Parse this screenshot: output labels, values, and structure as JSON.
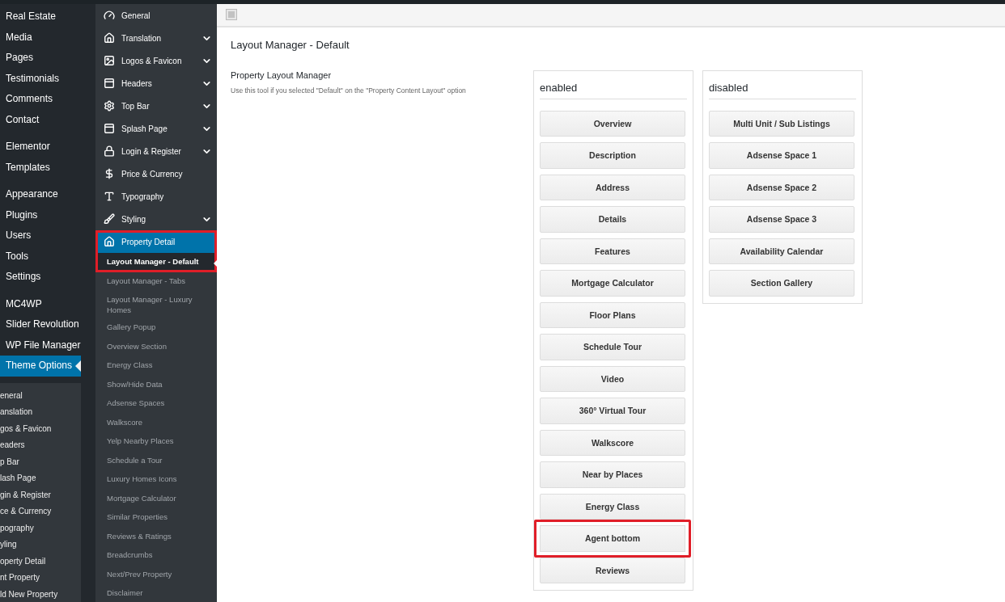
{
  "admin_menu": {
    "groups": [
      {
        "items": [
          {
            "label": "Real Estate",
            "selected": false
          },
          {
            "label": "Media",
            "selected": false
          },
          {
            "label": "Pages",
            "selected": false
          },
          {
            "label": "Testimonials",
            "selected": false
          },
          {
            "label": "Comments",
            "selected": false
          },
          {
            "label": "Contact",
            "selected": false
          }
        ]
      },
      {
        "items": [
          {
            "label": "Elementor",
            "selected": false
          },
          {
            "label": "Templates",
            "selected": false
          }
        ]
      },
      {
        "items": [
          {
            "label": "Appearance",
            "selected": false
          },
          {
            "label": "Plugins",
            "selected": false
          },
          {
            "label": "Users",
            "selected": false
          },
          {
            "label": "Tools",
            "selected": false
          },
          {
            "label": "Settings",
            "selected": false
          }
        ]
      },
      {
        "items": [
          {
            "label": "MC4WP",
            "selected": false
          },
          {
            "label": "Slider Revolution",
            "selected": false
          },
          {
            "label": "WP File Manager",
            "selected": false
          },
          {
            "label": "Theme Options",
            "selected": true
          }
        ]
      }
    ],
    "submenu": [
      "eneral",
      "anslation",
      "gos & Favicon",
      "eaders",
      "p Bar",
      "lash Page",
      "gin & Register",
      "ce & Currency",
      "pography",
      "yling",
      "operty Detail",
      "nt Property",
      "ld New Property"
    ]
  },
  "options_menu": {
    "sections": [
      {
        "label": "General",
        "expandable": false,
        "selected": false,
        "highlighted": false
      },
      {
        "label": "Translation",
        "expandable": true,
        "selected": false,
        "highlighted": false
      },
      {
        "label": "Logos & Favicon",
        "expandable": true,
        "selected": false,
        "highlighted": false
      },
      {
        "label": "Headers",
        "expandable": true,
        "selected": false,
        "highlighted": false
      },
      {
        "label": "Top Bar",
        "expandable": true,
        "selected": false,
        "highlighted": false
      },
      {
        "label": "Splash Page",
        "expandable": true,
        "selected": false,
        "highlighted": false
      },
      {
        "label": "Login & Register",
        "expandable": true,
        "selected": false,
        "highlighted": false
      },
      {
        "label": "Price & Currency",
        "expandable": false,
        "selected": false,
        "highlighted": false
      },
      {
        "label": "Typography",
        "expandable": false,
        "selected": false,
        "highlighted": false
      },
      {
        "label": "Styling",
        "expandable": true,
        "selected": false,
        "highlighted": false
      },
      {
        "label": "Property Detail",
        "expandable": false,
        "selected": true,
        "highlighted": true
      }
    ],
    "subitems": [
      {
        "label": "Layout Manager - Default",
        "selected": true,
        "highlighted": true
      },
      {
        "label": "Layout Manager - Tabs",
        "selected": false,
        "highlighted": false
      },
      {
        "label": "Layout Manager - Luxury Homes",
        "selected": false,
        "highlighted": false
      },
      {
        "label": "Gallery Popup",
        "selected": false,
        "highlighted": false
      },
      {
        "label": "Overview Section",
        "selected": false,
        "highlighted": false
      },
      {
        "label": "Energy Class",
        "selected": false,
        "highlighted": false
      },
      {
        "label": "Show/Hide Data",
        "selected": false,
        "highlighted": false
      },
      {
        "label": "Adsense Spaces",
        "selected": false,
        "highlighted": false
      },
      {
        "label": "Walkscore",
        "selected": false,
        "highlighted": false
      },
      {
        "label": "Yelp Nearby Places",
        "selected": false,
        "highlighted": false
      },
      {
        "label": "Schedule a Tour",
        "selected": false,
        "highlighted": false
      },
      {
        "label": "Luxury Homes Icons",
        "selected": false,
        "highlighted": false
      },
      {
        "label": "Mortgage Calculator",
        "selected": false,
        "highlighted": false
      },
      {
        "label": "Similar Properties",
        "selected": false,
        "highlighted": false
      },
      {
        "label": "Reviews & Ratings",
        "selected": false,
        "highlighted": false
      },
      {
        "label": "Breadcrumbs",
        "selected": false,
        "highlighted": false
      },
      {
        "label": "Next/Prev Property",
        "selected": false,
        "highlighted": false
      },
      {
        "label": "Disclaimer",
        "selected": false,
        "highlighted": false
      }
    ]
  },
  "page": {
    "title": "Layout Manager - Default",
    "field": {
      "label": "Property Layout Manager",
      "description": "Use this tool if you selected \"Default\" on the \"Property Content Layout\" option"
    },
    "columns": [
      {
        "title": "enabled",
        "items": [
          {
            "label": "Overview",
            "highlighted": false
          },
          {
            "label": "Description",
            "highlighted": false
          },
          {
            "label": "Address",
            "highlighted": false
          },
          {
            "label": "Details",
            "highlighted": false
          },
          {
            "label": "Features",
            "highlighted": false
          },
          {
            "label": "Mortgage Calculator",
            "highlighted": false
          },
          {
            "label": "Floor Plans",
            "highlighted": false
          },
          {
            "label": "Schedule Tour",
            "highlighted": false
          },
          {
            "label": "Video",
            "highlighted": false
          },
          {
            "label": "360° Virtual Tour",
            "highlighted": false
          },
          {
            "label": "Walkscore",
            "highlighted": false
          },
          {
            "label": "Near by Places",
            "highlighted": false
          },
          {
            "label": "Energy Class",
            "highlighted": false
          },
          {
            "label": "Agent bottom",
            "highlighted": true
          },
          {
            "label": "Reviews",
            "highlighted": false
          }
        ]
      },
      {
        "title": "disabled",
        "items": [
          {
            "label": "Multi Unit / Sub Listings",
            "highlighted": false
          },
          {
            "label": "Adsense Space 1",
            "highlighted": false
          },
          {
            "label": "Adsense Space 2",
            "highlighted": false
          },
          {
            "label": "Adsense Space 3",
            "highlighted": false
          },
          {
            "label": "Availability Calendar",
            "highlighted": false
          },
          {
            "label": "Section Gallery",
            "highlighted": false
          }
        ]
      }
    ]
  }
}
